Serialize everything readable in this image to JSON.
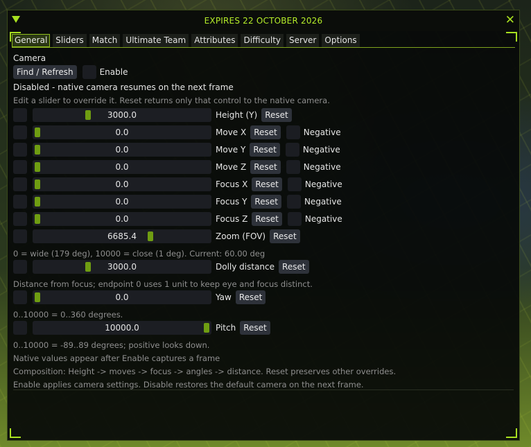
{
  "window": {
    "title": "EXPIRES 22 OCTOBER 2026",
    "close_glyph": "✕",
    "accent": "#a8e020"
  },
  "tabs": [
    "General",
    "Sliders",
    "Match",
    "Ultimate Team",
    "Attributes",
    "Difficulty",
    "Server",
    "Options"
  ],
  "active_tab": "General",
  "camera": {
    "section_label": "Camera",
    "find_refresh": "Find / Refresh",
    "enable_label": "Enable",
    "status": "Disabled - native camera resumes on the next frame",
    "hint": "Edit a slider to override it. Reset returns only that control to the native camera.",
    "reset_label": "Reset",
    "negative_label": "Negative",
    "sliders": [
      {
        "name": "Height (Y)",
        "value": "3000.0",
        "fraction": 0.3,
        "negative": false
      },
      {
        "name": "Move X",
        "value": "0.0",
        "fraction": 0.0,
        "negative": true
      },
      {
        "name": "Move Y",
        "value": "0.0",
        "fraction": 0.0,
        "negative": true
      },
      {
        "name": "Move Z",
        "value": "0.0",
        "fraction": 0.0,
        "negative": true
      },
      {
        "name": "Focus X",
        "value": "0.0",
        "fraction": 0.0,
        "negative": true
      },
      {
        "name": "Focus Y",
        "value": "0.0",
        "fraction": 0.0,
        "negative": true
      },
      {
        "name": "Focus Z",
        "value": "0.0",
        "fraction": 0.0,
        "negative": true
      },
      {
        "name": "Zoom (FOV)",
        "value": "6685.4",
        "fraction": 0.6685,
        "negative": false
      }
    ],
    "zoom_note": "0 = wide (179 deg), 10000 = close (1 deg). Current: 60.00 deg",
    "dolly": {
      "name": "Dolly distance",
      "value": "3000.0",
      "fraction": 0.3
    },
    "dolly_note": "Distance from focus; endpoint 0 uses 1 unit to keep eye and focus distinct.",
    "yaw": {
      "name": "Yaw",
      "value": "0.0",
      "fraction": 0.0
    },
    "yaw_note": "0..10000 = 0..360 degrees.",
    "pitch": {
      "name": "Pitch",
      "value": "10000.0",
      "fraction": 1.0
    },
    "pitch_note": "0..10000 = -89..89 degrees; positive looks down.",
    "notes": [
      "Native values appear after Enable captures a frame",
      "Composition: Height -> moves -> focus -> angles -> distance. Reset preserves other overrides.",
      "Enable applies camera settings. Disable restores the default camera on the next frame."
    ]
  }
}
